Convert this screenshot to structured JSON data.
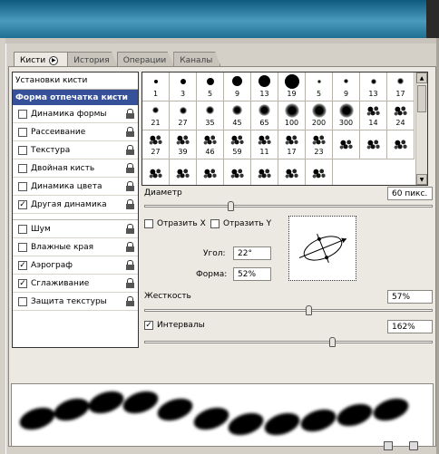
{
  "tabs": [
    {
      "label": "Кисти",
      "active": true
    },
    {
      "label": "История",
      "active": false
    },
    {
      "label": "Операции",
      "active": false
    },
    {
      "label": "Каналы",
      "active": false
    }
  ],
  "left_list": {
    "header": "Установки кисти",
    "selected": "Форма отпечатка кисти",
    "group1": [
      {
        "label": "Динамика формы",
        "checked": false
      },
      {
        "label": "Рассеивание",
        "checked": false
      },
      {
        "label": "Текстура",
        "checked": false
      },
      {
        "label": "Двойная кисть",
        "checked": false
      },
      {
        "label": "Динамика цвета",
        "checked": false
      },
      {
        "label": "Другая динамика",
        "checked": true
      }
    ],
    "group2": [
      {
        "label": "Шум",
        "checked": false
      },
      {
        "label": "Влажные края",
        "checked": false
      },
      {
        "label": "Аэрограф",
        "checked": true
      },
      {
        "label": "Сглаживание",
        "checked": true
      },
      {
        "label": "Защита текстуры",
        "checked": false
      }
    ]
  },
  "brush_presets": [
    "1",
    "3",
    "5",
    "9",
    "13",
    "19",
    "5",
    "9",
    "13",
    "17",
    "21",
    "27",
    "35",
    "45",
    "65",
    "100",
    "200",
    "300",
    "14",
    "24",
    "27",
    "39",
    "46",
    "59",
    "11",
    "17",
    "23"
  ],
  "diameter": {
    "label": "Диаметр",
    "value": "60 пикс.",
    "fraction": 0.3
  },
  "flip": {
    "x_label": "Отразить X",
    "y_label": "Отразить Y",
    "x_checked": false,
    "y_checked": false
  },
  "angle": {
    "label": "Угол:",
    "value": "22°"
  },
  "roundness": {
    "label": "Форма:",
    "value": "52%"
  },
  "hardness": {
    "label": "Жесткость",
    "value": "57%",
    "fraction": 0.57
  },
  "spacing": {
    "label": "Интервалы",
    "value": "162%",
    "checked": true,
    "fraction": 0.65
  },
  "icons": {
    "tab_menu": "play-circle-icon",
    "lock": "lock-icon",
    "new": "new-brush-icon",
    "trash": "trash-icon"
  }
}
